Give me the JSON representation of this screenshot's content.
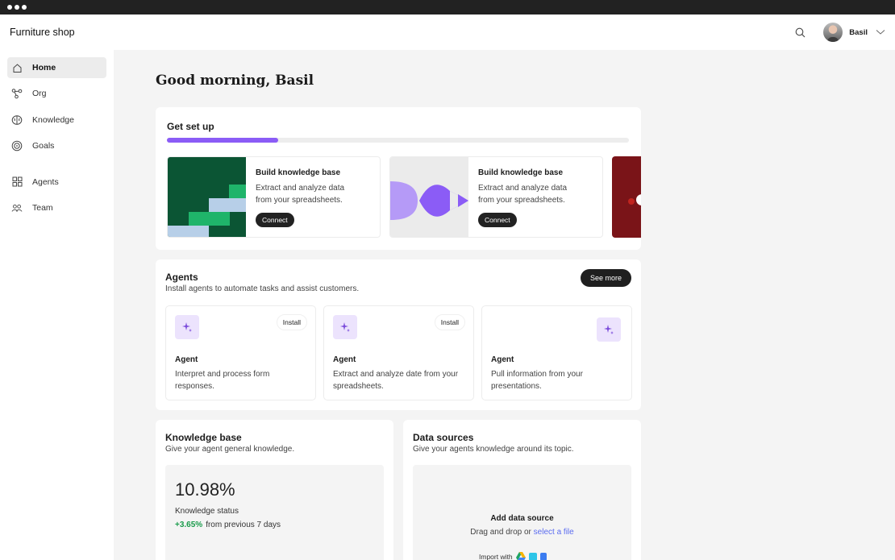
{
  "app": {
    "title": "Furniture shop"
  },
  "user": {
    "name": "Basil"
  },
  "sidebar": {
    "items": [
      {
        "label": "Home",
        "icon": "home-icon",
        "active": true
      },
      {
        "label": "Org",
        "icon": "org-icon"
      },
      {
        "label": "Knowledge",
        "icon": "brain-icon"
      },
      {
        "label": "Goals",
        "icon": "target-icon"
      },
      {
        "label": "Agents",
        "icon": "grid-icon"
      },
      {
        "label": "Team",
        "icon": "team-icon"
      }
    ]
  },
  "greeting": "Good morning, Basil",
  "setup": {
    "title": "Get set up",
    "progress": 0.24,
    "accent": "#8b5cf6",
    "tiles": [
      {
        "title": "Build knowledge base",
        "desc": "Extract and analyze data from your spreadsheets.",
        "button": "Connect"
      },
      {
        "title": "Build knowledge base",
        "desc": "Extract and analyze data from your spreadsheets.",
        "button": "Connect"
      }
    ]
  },
  "agents": {
    "title": "Agents",
    "subtitle": "Install agents to automate tasks and assist customers.",
    "see_more": "See more",
    "cards": [
      {
        "name": "Agent",
        "desc": "Interpret and process form responses.",
        "install": "Install"
      },
      {
        "name": "Agent",
        "desc": "Extract and analyze date from your spreadsheets.",
        "install": "Install"
      },
      {
        "name": "Agent",
        "desc": "Pull information from your presentations."
      }
    ]
  },
  "knowledge": {
    "title": "Knowledge base",
    "subtitle": "Give your agent general knowledge.",
    "value": "10.98%",
    "status_label": "Knowledge status",
    "delta": "+3.65%",
    "delta_suffix": "from previous 7 days",
    "positive_color": "#1a9b4b"
  },
  "datasources": {
    "title": "Data sources",
    "subtitle": "Give your agents knowledge around its topic.",
    "add": "Add data source",
    "drag_prefix": "Drag and drop or",
    "select_file": "select a file",
    "import_with": "Import with"
  }
}
